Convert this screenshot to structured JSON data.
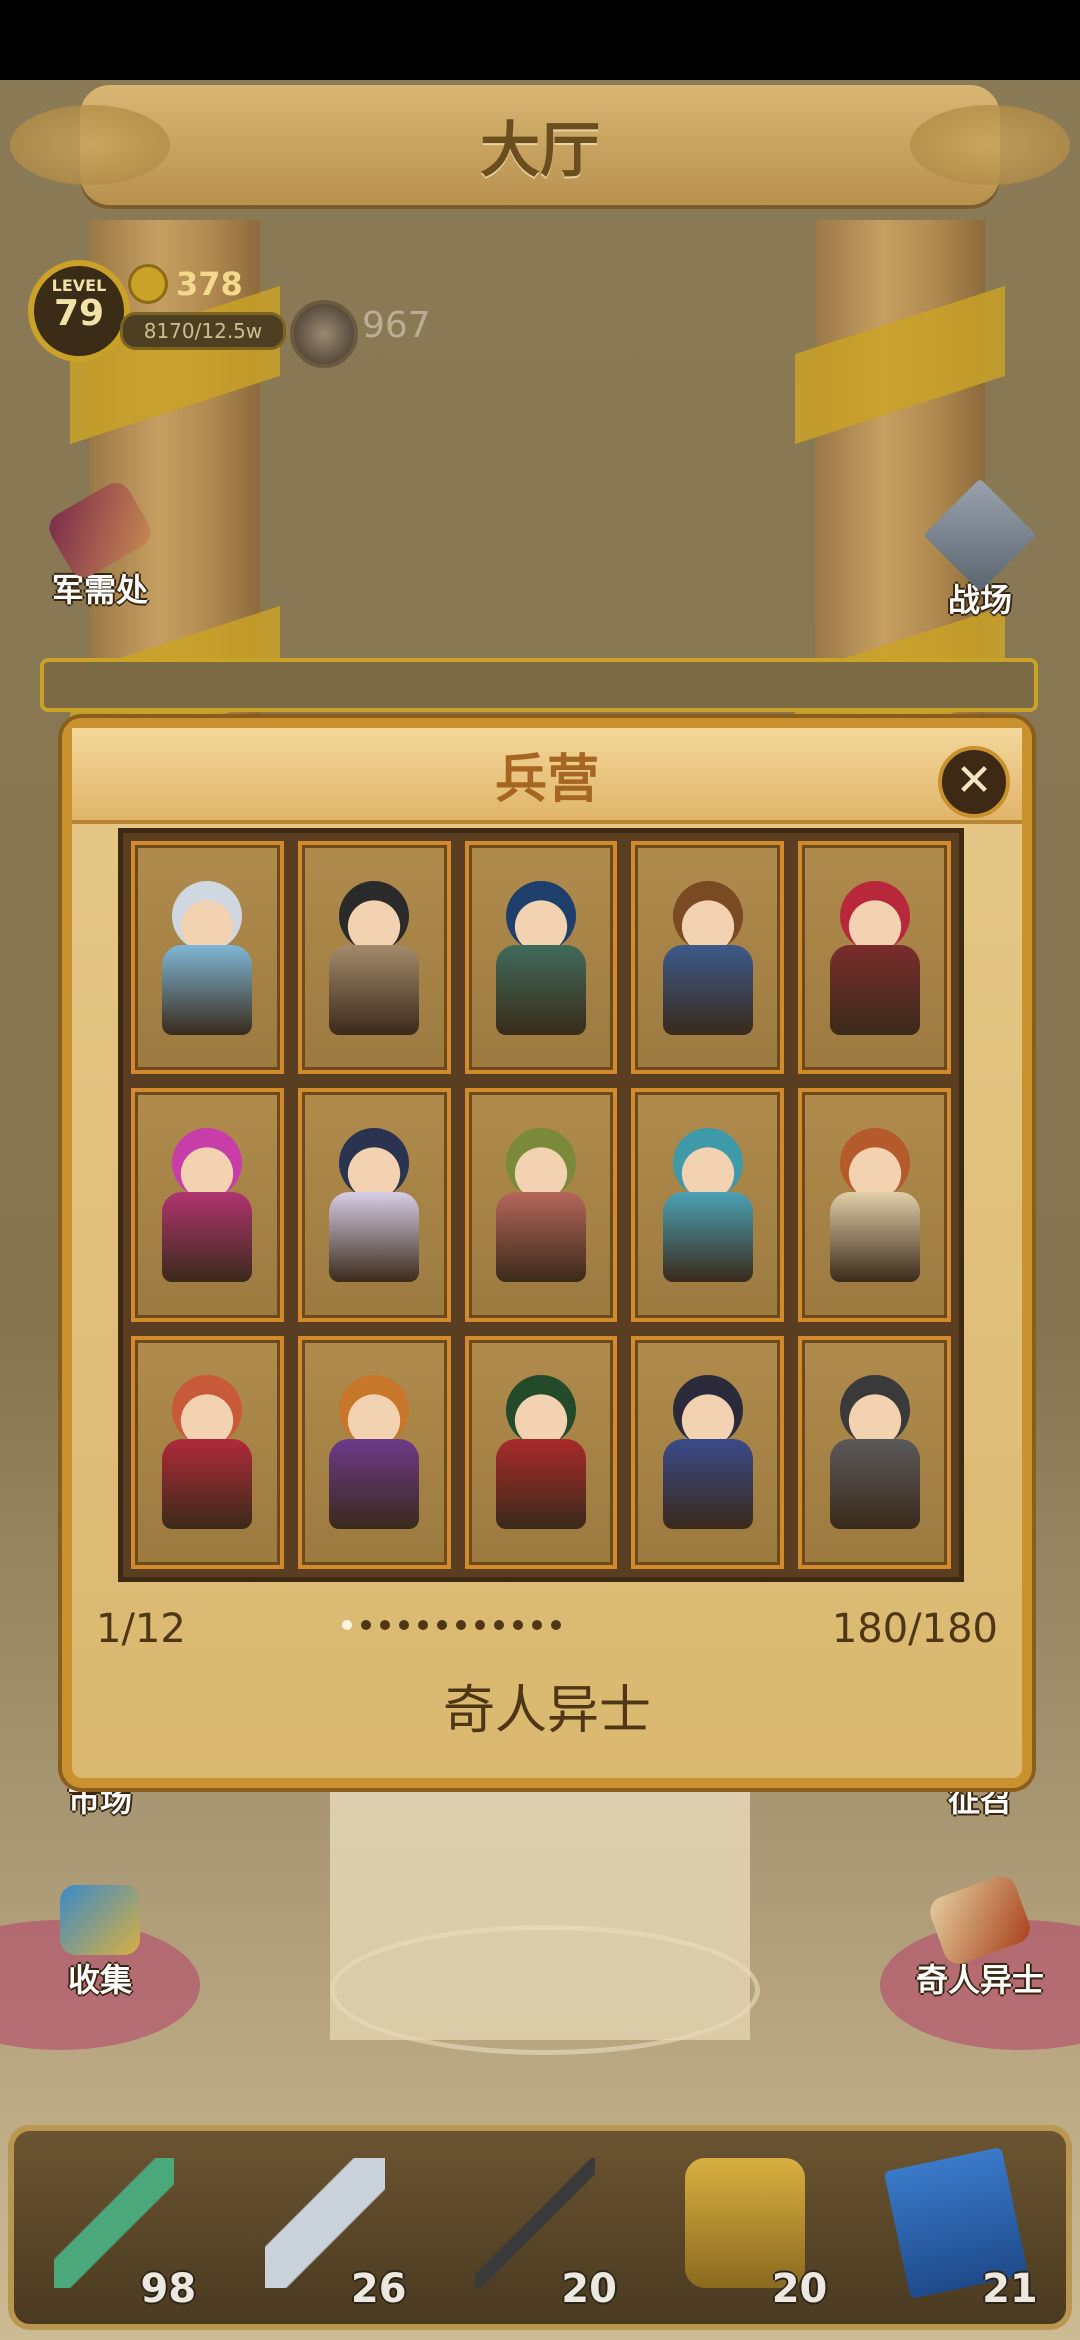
{
  "header": {
    "title": "大厅"
  },
  "player": {
    "level_caption": "LEVEL",
    "level": "79",
    "gold": "378",
    "xp": "8170/12.5w",
    "gems": "967"
  },
  "side_buttons": {
    "quartermaster": "军需处",
    "battlefield": "战场",
    "market": "市场",
    "recruit": "征召",
    "collection": "收集",
    "heroes": "奇人异士"
  },
  "dialog": {
    "title": "兵营",
    "close_icon": "close-icon",
    "page": "1/12",
    "dots_total": 12,
    "dots_active": 0,
    "count": "180/180",
    "caption": "奇人异士",
    "characters": [
      {
        "hair": "#cfd8e0",
        "armor": "#7fb7d6"
      },
      {
        "hair": "#2a2a2a",
        "armor": "#a38b6b"
      },
      {
        "hair": "#1e3f6b",
        "armor": "#3f6b5a"
      },
      {
        "hair": "#7a4a22",
        "armor": "#3d5a8a"
      },
      {
        "hair": "#b8283a",
        "armor": "#7a2c2c"
      },
      {
        "hair": "#c83ea8",
        "armor": "#b0346f"
      },
      {
        "hair": "#2a3350",
        "armor": "#d8cde6"
      },
      {
        "hair": "#7a8a3a",
        "armor": "#b5665a"
      },
      {
        "hair": "#3e9aa8",
        "armor": "#4aa1b5"
      },
      {
        "hair": "#b55a2a",
        "armor": "#e0cfa8"
      },
      {
        "hair": "#c85a3a",
        "armor": "#b02a3a"
      },
      {
        "hair": "#c8762a",
        "armor": "#6c3a8a"
      },
      {
        "hair": "#234a2a",
        "armor": "#a82a2a"
      },
      {
        "hair": "#2a2a3a",
        "armor": "#3a4a8a"
      },
      {
        "hair": "#3a3a3a",
        "armor": "#5a5a5a"
      }
    ]
  },
  "inventory": [
    {
      "icon": "jade-sword-icon",
      "count": "98"
    },
    {
      "icon": "saber-icon",
      "count": "26"
    },
    {
      "icon": "spear-icon",
      "count": "20"
    },
    {
      "icon": "armor-icon",
      "count": "20"
    },
    {
      "icon": "book-icon",
      "count": "21"
    }
  ]
}
